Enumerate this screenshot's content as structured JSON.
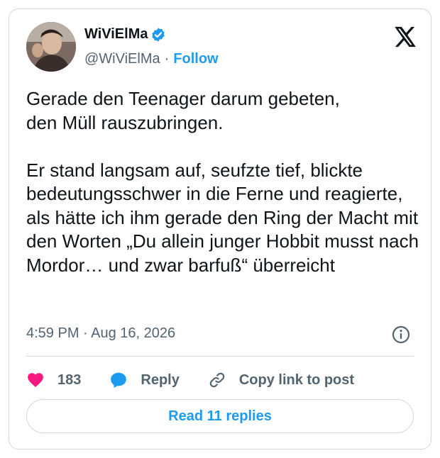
{
  "user": {
    "display_name": "WiViElMa",
    "handle": "@WiViElMa",
    "follow_label": "Follow",
    "verified_badge_icon": "verified-badge-icon",
    "avatar_icon": "avatar-photo"
  },
  "tweet": {
    "text": "Gerade den Teenager darum gebeten,\nden Müll rauszubringen.\n\nEr stand langsam auf, seufzte tief, blickte bedeutungsschwer in die Ferne und reagierte, als hätte ich ihm gerade den Ring  der Macht mit den Worten „Du allein junger Hobbit musst nach Mordor… und zwar barfuß“ überreicht",
    "timestamp": "4:59 PM · Aug 16, 2026"
  },
  "actions": {
    "like_count": "183",
    "reply_label": "Reply",
    "copy_label": "Copy link to post"
  },
  "read_replies_label": "Read 11 replies",
  "colors": {
    "accent": "#1d9bf0",
    "like": "#f91880",
    "muted": "#536471",
    "border": "#cfd9de"
  },
  "icons": [
    "x-logo-icon",
    "info-icon",
    "heart-icon",
    "reply-bubble-icon",
    "link-icon"
  ]
}
